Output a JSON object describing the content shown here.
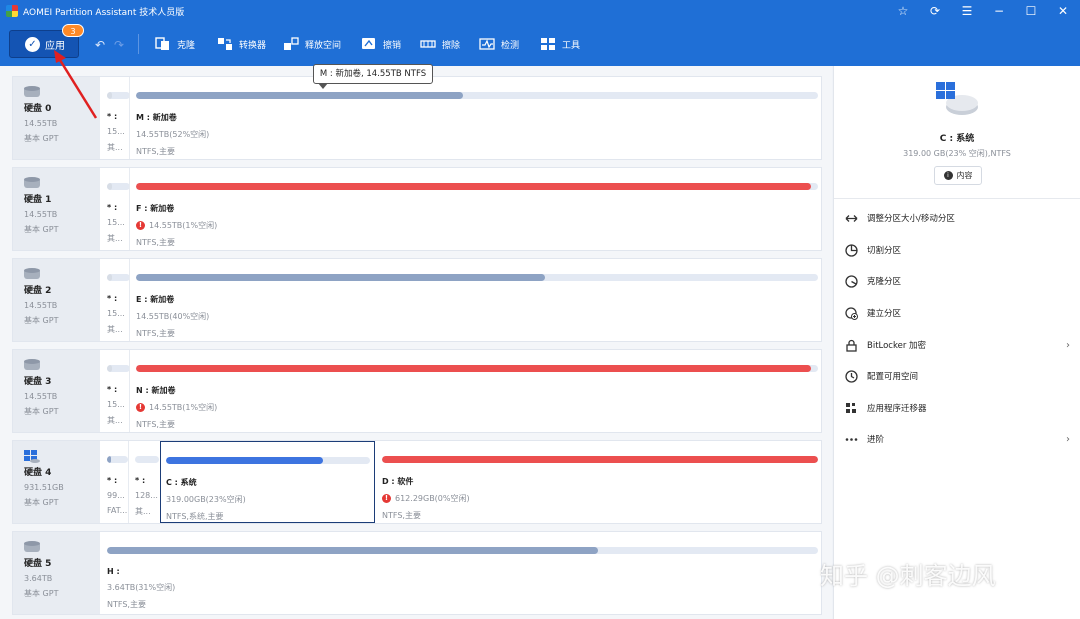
{
  "window": {
    "title": "AOMEI Partition Assistant 技术人员版",
    "controls": [
      "star-icon",
      "refresh-icon",
      "menu-icon",
      "minimize-icon",
      "maximize-icon",
      "close-icon"
    ]
  },
  "toolbar": {
    "apply_label": "应用",
    "apply_badge": "3",
    "items": [
      {
        "label": "克隆",
        "icon": "clone-icon"
      },
      {
        "label": "转换器",
        "icon": "convert-icon"
      },
      {
        "label": "释放空间",
        "icon": "free-space-icon"
      },
      {
        "label": "擦销",
        "icon": "wipe-icon"
      },
      {
        "label": "擦除",
        "icon": "erase-icon"
      },
      {
        "label": "检测",
        "icon": "test-icon"
      },
      {
        "label": "工具",
        "icon": "tools-icon"
      }
    ]
  },
  "tooltip": "M : 新加卷, 14.55TB NTFS",
  "disks": [
    {
      "name": "硬盘 0",
      "size": "14.55TB",
      "type": "基本 GPT",
      "partitions": [
        {
          "label": "* :",
          "size": "15...",
          "fs": "其...",
          "used": 0.2
        },
        {
          "label": "M : 新加卷",
          "size": "14.55TB(52%空闲)",
          "fs": "NTFS,主要",
          "used": 0.48,
          "color": "gray"
        }
      ]
    },
    {
      "name": "硬盘 1",
      "size": "14.55TB",
      "type": "基本 GPT",
      "partitions": [
        {
          "label": "* :",
          "size": "15...",
          "fs": "其...",
          "used": 0.2
        },
        {
          "label": "F : 新加卷",
          "size": "14.55TB(1%空闲)",
          "fs": "NTFS,主要",
          "used": 0.99,
          "color": "red",
          "warn": true
        }
      ]
    },
    {
      "name": "硬盘 2",
      "size": "14.55TB",
      "type": "基本 GPT",
      "partitions": [
        {
          "label": "* :",
          "size": "15...",
          "fs": "其...",
          "used": 0.2
        },
        {
          "label": "E : 新加卷",
          "size": "14.55TB(40%空闲)",
          "fs": "NTFS,主要",
          "used": 0.6,
          "color": "gray"
        }
      ]
    },
    {
      "name": "硬盘 3",
      "size": "14.55TB",
      "type": "基本 GPT",
      "partitions": [
        {
          "label": "* :",
          "size": "15...",
          "fs": "其...",
          "used": 0.2
        },
        {
          "label": "N : 新加卷",
          "size": "14.55TB(1%空闲)",
          "fs": "NTFS,主要",
          "used": 0.99,
          "color": "red",
          "warn": true
        }
      ]
    },
    {
      "name": "硬盘 4",
      "size": "931.51GB",
      "type": "基本 GPT",
      "partitions": [
        {
          "label": "* :",
          "size": "99...",
          "fs": "FAT...",
          "used": 0.2
        },
        {
          "label": "* :",
          "size": "128...",
          "fs": "其...",
          "used": 0.0
        },
        {
          "label": "C : 系统",
          "size": "319.00GB(23%空闲)",
          "fs": "NTFS,系统,主要",
          "used": 0.77,
          "color": "blue",
          "selected": true
        },
        {
          "label": "D : 软件",
          "size": "612.29GB(0%空闲)",
          "fs": "NTFS,主要",
          "used": 1.0,
          "color": "red",
          "warn": true
        }
      ]
    },
    {
      "name": "硬盘 5",
      "size": "3.64TB",
      "type": "基本 GPT",
      "partitions": [
        {
          "label": "H :",
          "size": "3.64TB(31%空闲)",
          "fs": "NTFS,主要",
          "used": 0.69,
          "color": "gray"
        }
      ]
    }
  ],
  "side_panel": {
    "selected_name": "C : 系统",
    "selected_detail": "319.00 GB(23% 空闲),NTFS",
    "props_label": "内容",
    "actions": [
      {
        "label": "调整分区大小/移动分区",
        "icon": "resize-icon"
      },
      {
        "label": "切割分区",
        "icon": "split-icon"
      },
      {
        "label": "克隆分区",
        "icon": "clone-partition-icon"
      },
      {
        "label": "建立分区",
        "icon": "create-partition-icon"
      },
      {
        "label": "BitLocker 加密",
        "icon": "lock-icon",
        "submenu": true
      },
      {
        "label": "配置可用空间",
        "icon": "allocate-icon"
      },
      {
        "label": "应用程序迁移器",
        "icon": "app-mover-icon"
      },
      {
        "label": "进阶",
        "icon": "more-icon",
        "submenu": true
      }
    ]
  },
  "watermark": "知乎 @刺客边风"
}
